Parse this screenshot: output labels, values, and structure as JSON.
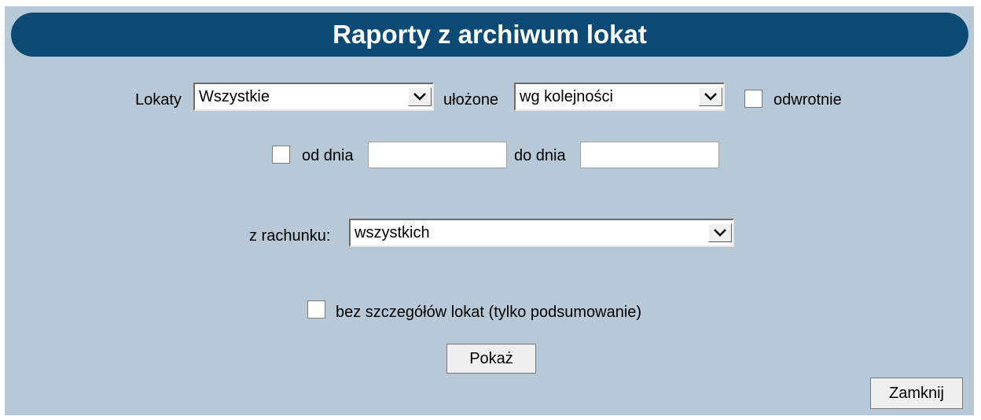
{
  "title": "Raporty z archiwum lokat",
  "row1": {
    "lokaty_label": "Lokaty",
    "lokaty_value": "Wszystkie",
    "ulozone_label": "ułożone",
    "ulozone_value": "wg kolejności",
    "odwrotnie_label": "odwrotnie",
    "odwrotnie_checked": false
  },
  "row2": {
    "od_dnia_label": "od dnia",
    "od_dnia_value": "",
    "do_dnia_label": "do dnia",
    "do_dnia_value": "",
    "date_checked": false
  },
  "row3": {
    "rachunek_label": "z rachunku:",
    "rachunek_value": "wszystkich"
  },
  "row4": {
    "summary_label": "bez szczegółów lokat (tylko podsumowanie)",
    "summary_checked": false
  },
  "buttons": {
    "show": "Pokaż",
    "close": "Zamknij"
  },
  "icons": {
    "dropdown": "chevron-down-icon"
  }
}
